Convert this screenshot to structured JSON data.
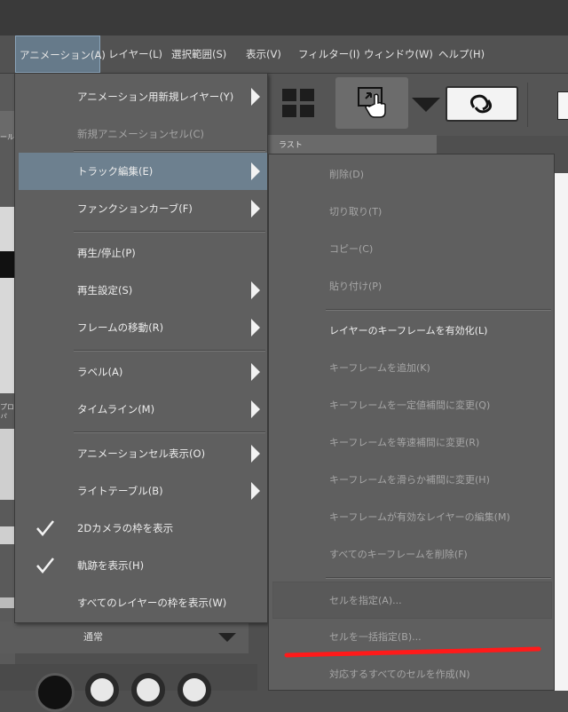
{
  "menubar": {
    "items": [
      {
        "label": "アニメーション(A)",
        "active": true
      },
      {
        "label": "レイヤー(L)"
      },
      {
        "label": "選択範囲(S)"
      },
      {
        "label": "表示(V)"
      },
      {
        "label": "フィルター(I)"
      },
      {
        "label": "ウィンドウ(W)"
      },
      {
        "label": "ヘルプ(H)"
      }
    ]
  },
  "background": {
    "layer_tab": "ラスト",
    "side_label_1": "ール",
    "side_label_2": "プロパ",
    "blend_mode": "通常"
  },
  "main_menu": {
    "items": [
      {
        "label": "アニメーション用新規レイヤー(Y)",
        "submenu": true
      },
      {
        "label": "新規アニメーションセル(C)",
        "disabled": true
      },
      {
        "label": "トラック編集(E)",
        "submenu": true,
        "highlighted": true
      },
      {
        "label": "ファンクションカーブ(F)",
        "submenu": true
      },
      {
        "label": "再生/停止(P)"
      },
      {
        "label": "再生設定(S)",
        "submenu": true
      },
      {
        "label": "フレームの移動(R)",
        "submenu": true
      },
      {
        "label": "ラベル(A)",
        "submenu": true
      },
      {
        "label": "タイムライン(M)",
        "submenu": true
      },
      {
        "label": "アニメーションセル表示(O)",
        "submenu": true
      },
      {
        "label": "ライトテーブル(B)",
        "submenu": true
      },
      {
        "label": "2Dカメラの枠を表示",
        "checked": true
      },
      {
        "label": "軌跡を表示(H)",
        "checked": true
      },
      {
        "label": "すべてのレイヤーの枠を表示(W)"
      }
    ]
  },
  "sub_menu": {
    "items": [
      {
        "label": "削除(D)"
      },
      {
        "label": "切り取り(T)"
      },
      {
        "label": "コピー(C)"
      },
      {
        "label": "貼り付け(P)"
      },
      {
        "label": "レイヤーのキーフレームを有効化(L)",
        "enabled": true
      },
      {
        "label": "キーフレームを追加(K)"
      },
      {
        "label": "キーフレームを一定値補間に変更(Q)"
      },
      {
        "label": "キーフレームを等速補間に変更(R)"
      },
      {
        "label": "キーフレームを滑らか補間に変更(H)"
      },
      {
        "label": "キーフレームが有効なレイヤーの編集(M)"
      },
      {
        "label": "すべてのキーフレームを削除(F)"
      },
      {
        "label": "セルを指定(A)..."
      },
      {
        "label": "セルを一括指定(B)..."
      },
      {
        "label": "対応するすべてのセルを作成(N)"
      }
    ]
  },
  "colors": {
    "highlight": "#6d808f",
    "annotation": "#ff1a1a"
  },
  "icons": [
    "checkmark-icon",
    "submenu-arrow-icon",
    "grid-view-icon",
    "hand-pointer-icon",
    "link-icon",
    "dropdown-arrow-icon"
  ]
}
